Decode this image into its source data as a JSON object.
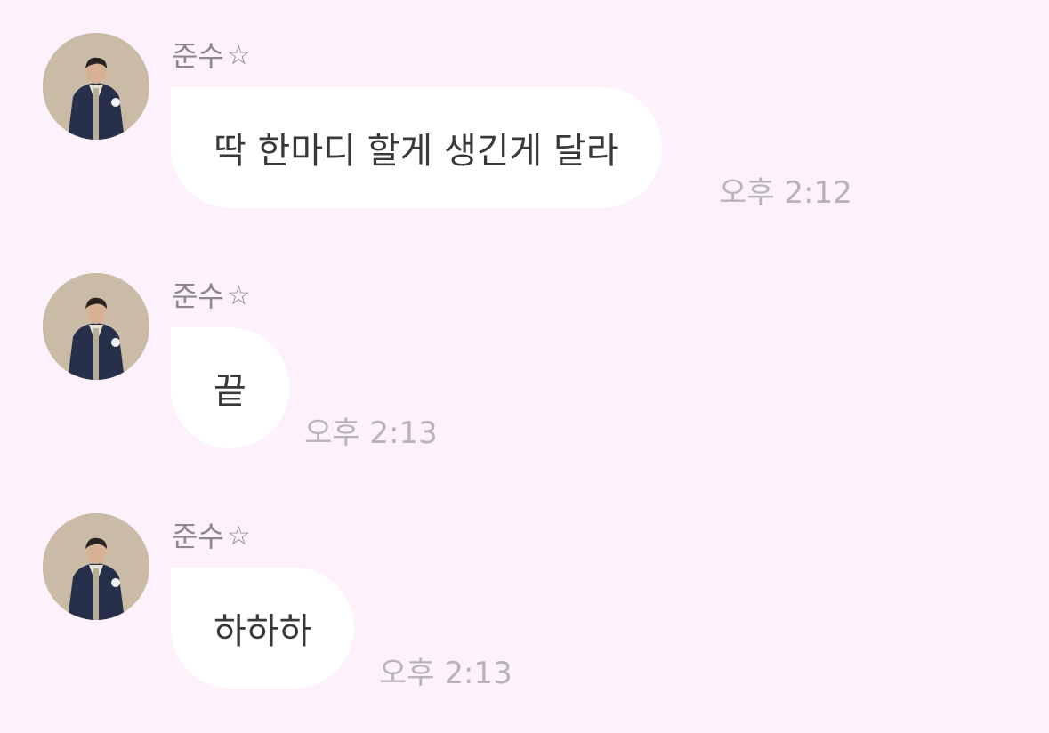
{
  "messages": [
    {
      "sender": "준수",
      "sender_icon": "star-outline-icon",
      "text": "딱 한마디 할게 생긴게 달라",
      "time": "오후 2:12"
    },
    {
      "sender": "준수",
      "sender_icon": "star-outline-icon",
      "text": "끝",
      "time": "오후 2:13"
    },
    {
      "sender": "준수",
      "sender_icon": "star-outline-icon",
      "text": "하하하",
      "time": "오후 2:13"
    }
  ],
  "colors": {
    "background": "#fdf1fb",
    "bubble": "#ffffff",
    "sender_text": "#8b8790",
    "message_text": "#3a383d",
    "time_text": "#b7b3bb"
  }
}
